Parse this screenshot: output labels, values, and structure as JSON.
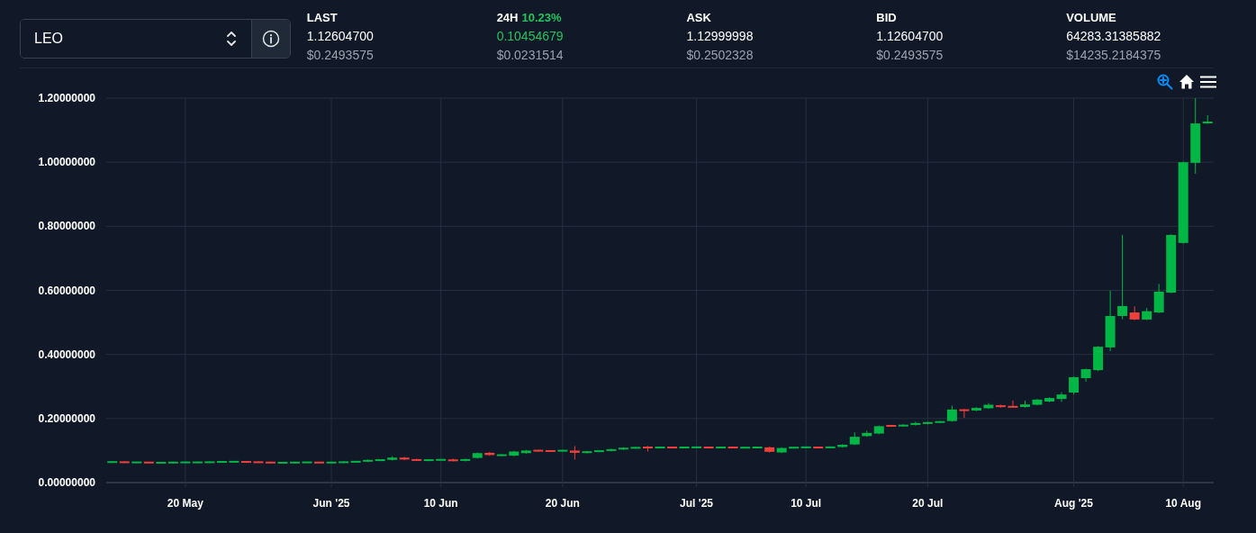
{
  "market_selector": {
    "value": "LEO"
  },
  "stats": [
    {
      "kind": "plain",
      "label": "LAST",
      "value": "1.12604700",
      "usd": "$0.2493575"
    },
    {
      "kind": "change",
      "label": "24H",
      "change": "10.23%",
      "value": "0.10454679",
      "usd": "$0.0231514"
    },
    {
      "kind": "plain",
      "label": "ASK",
      "value": "1.12999998",
      "usd": "$0.2502328"
    },
    {
      "kind": "plain",
      "label": "BID",
      "value": "1.12604700",
      "usd": "$0.2493575"
    },
    {
      "kind": "plain",
      "label": "VOLUME",
      "value": "64283.31385882",
      "usd": "$14235.2184375"
    }
  ],
  "chart": {
    "chart_data": {
      "type": "candlestick",
      "grid": true,
      "ylim": [
        0,
        1.2
      ],
      "yticks": [
        {
          "value": 0,
          "label": "0.00000000"
        },
        {
          "value": 0.2,
          "label": "0.20000000"
        },
        {
          "value": 0.4,
          "label": "0.40000000"
        },
        {
          "value": 0.6,
          "label": "0.60000000"
        },
        {
          "value": 0.8,
          "label": "0.80000000"
        },
        {
          "value": 1.0,
          "label": "1.00000000"
        },
        {
          "value": 1.2,
          "label": "1.20000000"
        }
      ],
      "categories": [
        null,
        null,
        null,
        null,
        null,
        null,
        "20 May",
        null,
        null,
        null,
        null,
        null,
        null,
        null,
        null,
        null,
        null,
        null,
        "Jun '25",
        null,
        null,
        null,
        null,
        null,
        null,
        null,
        null,
        "10 Jun",
        null,
        null,
        null,
        null,
        null,
        null,
        null,
        null,
        null,
        "20 Jun",
        null,
        null,
        null,
        null,
        null,
        null,
        null,
        null,
        null,
        null,
        "Jul '25",
        null,
        null,
        null,
        null,
        null,
        null,
        null,
        null,
        "10 Jul",
        null,
        null,
        null,
        null,
        null,
        null,
        null,
        null,
        null,
        "20 Jul",
        null,
        null,
        null,
        null,
        null,
        null,
        null,
        null,
        null,
        null,
        null,
        "Aug '25",
        null,
        null,
        null,
        null,
        null,
        null,
        null,
        null,
        "10 Aug",
        null,
        null
      ],
      "ohlc": [
        [
          0.064,
          0.066,
          0.062,
          0.064
        ],
        [
          0.064,
          0.066,
          0.062,
          0.063
        ],
        [
          0.063,
          0.065,
          0.061,
          0.063
        ],
        [
          0.063,
          0.065,
          0.061,
          0.062
        ],
        [
          0.062,
          0.064,
          0.06,
          0.062
        ],
        [
          0.062,
          0.065,
          0.06,
          0.063
        ],
        [
          0.063,
          0.065,
          0.061,
          0.063
        ],
        [
          0.063,
          0.065,
          0.061,
          0.063
        ],
        [
          0.063,
          0.066,
          0.061,
          0.064
        ],
        [
          0.064,
          0.067,
          0.062,
          0.065
        ],
        [
          0.065,
          0.067,
          0.063,
          0.065
        ],
        [
          0.065,
          0.067,
          0.062,
          0.064
        ],
        [
          0.064,
          0.066,
          0.062,
          0.063
        ],
        [
          0.063,
          0.065,
          0.061,
          0.062
        ],
        [
          0.062,
          0.064,
          0.06,
          0.062
        ],
        [
          0.062,
          0.065,
          0.06,
          0.063
        ],
        [
          0.063,
          0.065,
          0.061,
          0.063
        ],
        [
          0.063,
          0.065,
          0.061,
          0.062
        ],
        [
          0.062,
          0.065,
          0.06,
          0.063
        ],
        [
          0.063,
          0.066,
          0.061,
          0.064
        ],
        [
          0.064,
          0.068,
          0.062,
          0.066
        ],
        [
          0.066,
          0.072,
          0.064,
          0.07
        ],
        [
          0.069,
          0.073,
          0.067,
          0.071
        ],
        [
          0.071,
          0.082,
          0.069,
          0.078
        ],
        [
          0.078,
          0.08,
          0.07,
          0.072
        ],
        [
          0.072,
          0.074,
          0.067,
          0.069
        ],
        [
          0.069,
          0.073,
          0.067,
          0.071
        ],
        [
          0.071,
          0.073,
          0.069,
          0.071
        ],
        [
          0.071,
          0.075,
          0.066,
          0.068
        ],
        [
          0.068,
          0.075,
          0.066,
          0.073
        ],
        [
          0.077,
          0.094,
          0.075,
          0.092
        ],
        [
          0.093,
          0.095,
          0.084,
          0.086
        ],
        [
          0.085,
          0.088,
          0.083,
          0.086
        ],
        [
          0.084,
          0.099,
          0.082,
          0.097
        ],
        [
          0.092,
          0.102,
          0.09,
          0.1
        ],
        [
          0.1,
          0.102,
          0.097,
          0.099
        ],
        [
          0.099,
          0.101,
          0.096,
          0.098
        ],
        [
          0.099,
          0.102,
          0.097,
          0.1
        ],
        [
          0.1,
          0.114,
          0.072,
          0.093
        ],
        [
          0.093,
          0.099,
          0.091,
          0.097
        ],
        [
          0.097,
          0.101,
          0.095,
          0.099
        ],
        [
          0.099,
          0.106,
          0.097,
          0.104
        ],
        [
          0.104,
          0.11,
          0.102,
          0.108
        ],
        [
          0.108,
          0.111,
          0.106,
          0.109
        ],
        [
          0.11,
          0.114,
          0.097,
          0.109
        ],
        [
          0.109,
          0.111,
          0.107,
          0.11
        ],
        [
          0.11,
          0.112,
          0.107,
          0.109
        ],
        [
          0.109,
          0.111,
          0.107,
          0.11
        ],
        [
          0.11,
          0.112,
          0.108,
          0.11
        ],
        [
          0.11,
          0.112,
          0.107,
          0.109
        ],
        [
          0.109,
          0.112,
          0.107,
          0.11
        ],
        [
          0.11,
          0.112,
          0.107,
          0.109
        ],
        [
          0.109,
          0.111,
          0.107,
          0.109
        ],
        [
          0.109,
          0.112,
          0.107,
          0.11
        ],
        [
          0.11,
          0.112,
          0.094,
          0.096
        ],
        [
          0.094,
          0.11,
          0.092,
          0.108
        ],
        [
          0.108,
          0.112,
          0.106,
          0.11
        ],
        [
          0.11,
          0.112,
          0.108,
          0.11
        ],
        [
          0.11,
          0.112,
          0.107,
          0.109
        ],
        [
          0.109,
          0.113,
          0.107,
          0.111
        ],
        [
          0.111,
          0.12,
          0.109,
          0.118
        ],
        [
          0.119,
          0.157,
          0.117,
          0.143
        ],
        [
          0.145,
          0.162,
          0.143,
          0.155
        ],
        [
          0.153,
          0.178,
          0.151,
          0.176
        ],
        [
          0.178,
          0.18,
          0.174,
          0.176
        ],
        [
          0.176,
          0.182,
          0.174,
          0.18
        ],
        [
          0.18,
          0.19,
          0.178,
          0.186
        ],
        [
          0.184,
          0.19,
          0.182,
          0.188
        ],
        [
          0.188,
          0.192,
          0.186,
          0.19
        ],
        [
          0.192,
          0.24,
          0.19,
          0.228
        ],
        [
          0.228,
          0.23,
          0.202,
          0.224
        ],
        [
          0.225,
          0.235,
          0.223,
          0.233
        ],
        [
          0.232,
          0.248,
          0.23,
          0.243
        ],
        [
          0.241,
          0.243,
          0.234,
          0.236
        ],
        [
          0.237,
          0.256,
          0.234,
          0.236
        ],
        [
          0.236,
          0.256,
          0.234,
          0.244
        ],
        [
          0.243,
          0.261,
          0.241,
          0.259
        ],
        [
          0.253,
          0.266,
          0.251,
          0.264
        ],
        [
          0.261,
          0.282,
          0.252,
          0.275
        ],
        [
          0.281,
          0.331,
          0.275,
          0.329
        ],
        [
          0.326,
          0.356,
          0.315,
          0.354
        ],
        [
          0.351,
          0.426,
          0.348,
          0.424
        ],
        [
          0.422,
          0.599,
          0.41,
          0.52
        ],
        [
          0.52,
          0.773,
          0.51,
          0.551
        ],
        [
          0.531,
          0.55,
          0.507,
          0.509
        ],
        [
          0.509,
          0.545,
          0.507,
          0.535
        ],
        [
          0.531,
          0.62,
          0.529,
          0.596
        ],
        [
          0.593,
          0.775,
          0.591,
          0.773
        ],
        [
          0.748,
          1.002,
          0.746,
          1.0
        ],
        [
          0.998,
          1.2,
          0.964,
          1.121
        ],
        [
          1.122,
          1.147,
          1.12,
          1.126
        ]
      ]
    }
  }
}
